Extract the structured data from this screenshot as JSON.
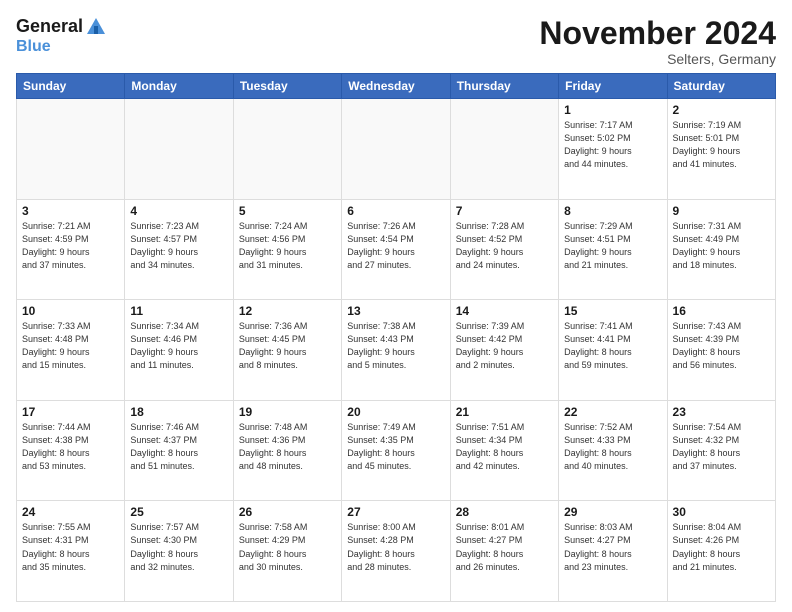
{
  "logo": {
    "line1": "General",
    "line2": "Blue"
  },
  "title": "November 2024",
  "location": "Selters, Germany",
  "days_of_week": [
    "Sunday",
    "Monday",
    "Tuesday",
    "Wednesday",
    "Thursday",
    "Friday",
    "Saturday"
  ],
  "weeks": [
    [
      {
        "day": "",
        "info": ""
      },
      {
        "day": "",
        "info": ""
      },
      {
        "day": "",
        "info": ""
      },
      {
        "day": "",
        "info": ""
      },
      {
        "day": "",
        "info": ""
      },
      {
        "day": "1",
        "info": "Sunrise: 7:17 AM\nSunset: 5:02 PM\nDaylight: 9 hours\nand 44 minutes."
      },
      {
        "day": "2",
        "info": "Sunrise: 7:19 AM\nSunset: 5:01 PM\nDaylight: 9 hours\nand 41 minutes."
      }
    ],
    [
      {
        "day": "3",
        "info": "Sunrise: 7:21 AM\nSunset: 4:59 PM\nDaylight: 9 hours\nand 37 minutes."
      },
      {
        "day": "4",
        "info": "Sunrise: 7:23 AM\nSunset: 4:57 PM\nDaylight: 9 hours\nand 34 minutes."
      },
      {
        "day": "5",
        "info": "Sunrise: 7:24 AM\nSunset: 4:56 PM\nDaylight: 9 hours\nand 31 minutes."
      },
      {
        "day": "6",
        "info": "Sunrise: 7:26 AM\nSunset: 4:54 PM\nDaylight: 9 hours\nand 27 minutes."
      },
      {
        "day": "7",
        "info": "Sunrise: 7:28 AM\nSunset: 4:52 PM\nDaylight: 9 hours\nand 24 minutes."
      },
      {
        "day": "8",
        "info": "Sunrise: 7:29 AM\nSunset: 4:51 PM\nDaylight: 9 hours\nand 21 minutes."
      },
      {
        "day": "9",
        "info": "Sunrise: 7:31 AM\nSunset: 4:49 PM\nDaylight: 9 hours\nand 18 minutes."
      }
    ],
    [
      {
        "day": "10",
        "info": "Sunrise: 7:33 AM\nSunset: 4:48 PM\nDaylight: 9 hours\nand 15 minutes."
      },
      {
        "day": "11",
        "info": "Sunrise: 7:34 AM\nSunset: 4:46 PM\nDaylight: 9 hours\nand 11 minutes."
      },
      {
        "day": "12",
        "info": "Sunrise: 7:36 AM\nSunset: 4:45 PM\nDaylight: 9 hours\nand 8 minutes."
      },
      {
        "day": "13",
        "info": "Sunrise: 7:38 AM\nSunset: 4:43 PM\nDaylight: 9 hours\nand 5 minutes."
      },
      {
        "day": "14",
        "info": "Sunrise: 7:39 AM\nSunset: 4:42 PM\nDaylight: 9 hours\nand 2 minutes."
      },
      {
        "day": "15",
        "info": "Sunrise: 7:41 AM\nSunset: 4:41 PM\nDaylight: 8 hours\nand 59 minutes."
      },
      {
        "day": "16",
        "info": "Sunrise: 7:43 AM\nSunset: 4:39 PM\nDaylight: 8 hours\nand 56 minutes."
      }
    ],
    [
      {
        "day": "17",
        "info": "Sunrise: 7:44 AM\nSunset: 4:38 PM\nDaylight: 8 hours\nand 53 minutes."
      },
      {
        "day": "18",
        "info": "Sunrise: 7:46 AM\nSunset: 4:37 PM\nDaylight: 8 hours\nand 51 minutes."
      },
      {
        "day": "19",
        "info": "Sunrise: 7:48 AM\nSunset: 4:36 PM\nDaylight: 8 hours\nand 48 minutes."
      },
      {
        "day": "20",
        "info": "Sunrise: 7:49 AM\nSunset: 4:35 PM\nDaylight: 8 hours\nand 45 minutes."
      },
      {
        "day": "21",
        "info": "Sunrise: 7:51 AM\nSunset: 4:34 PM\nDaylight: 8 hours\nand 42 minutes."
      },
      {
        "day": "22",
        "info": "Sunrise: 7:52 AM\nSunset: 4:33 PM\nDaylight: 8 hours\nand 40 minutes."
      },
      {
        "day": "23",
        "info": "Sunrise: 7:54 AM\nSunset: 4:32 PM\nDaylight: 8 hours\nand 37 minutes."
      }
    ],
    [
      {
        "day": "24",
        "info": "Sunrise: 7:55 AM\nSunset: 4:31 PM\nDaylight: 8 hours\nand 35 minutes."
      },
      {
        "day": "25",
        "info": "Sunrise: 7:57 AM\nSunset: 4:30 PM\nDaylight: 8 hours\nand 32 minutes."
      },
      {
        "day": "26",
        "info": "Sunrise: 7:58 AM\nSunset: 4:29 PM\nDaylight: 8 hours\nand 30 minutes."
      },
      {
        "day": "27",
        "info": "Sunrise: 8:00 AM\nSunset: 4:28 PM\nDaylight: 8 hours\nand 28 minutes."
      },
      {
        "day": "28",
        "info": "Sunrise: 8:01 AM\nSunset: 4:27 PM\nDaylight: 8 hours\nand 26 minutes."
      },
      {
        "day": "29",
        "info": "Sunrise: 8:03 AM\nSunset: 4:27 PM\nDaylight: 8 hours\nand 23 minutes."
      },
      {
        "day": "30",
        "info": "Sunrise: 8:04 AM\nSunset: 4:26 PM\nDaylight: 8 hours\nand 21 minutes."
      }
    ]
  ]
}
